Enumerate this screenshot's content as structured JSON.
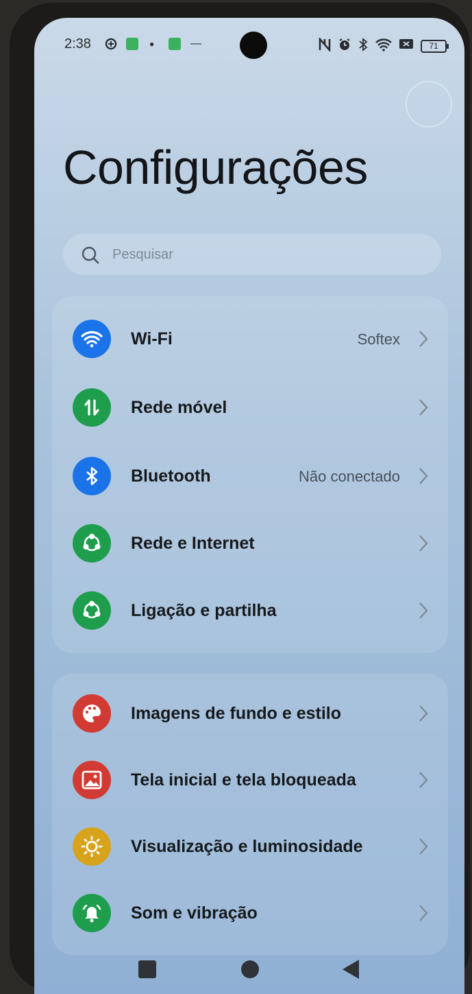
{
  "status_bar": {
    "time": "2:38",
    "battery": "71",
    "icons": [
      "alarm-icon",
      "bluetooth-icon",
      "wifi-icon",
      "nfc-icon"
    ]
  },
  "header": {
    "title": "Configurações"
  },
  "search": {
    "placeholder": "Pesquisar"
  },
  "groups": [
    {
      "items": [
        {
          "label": "Wi-Fi",
          "value": "Softex",
          "icon": "wifi-icon",
          "color": "#1a73e8"
        },
        {
          "label": "Rede móvel",
          "value": "",
          "icon": "mobile-data-icon",
          "color": "#1e9e4c"
        },
        {
          "label": "Bluetooth",
          "value": "Não conectado",
          "icon": "bluetooth-icon",
          "color": "#1a73e8"
        },
        {
          "label": "Rede e Internet",
          "value": "",
          "icon": "network-icon",
          "color": "#1e9e4c"
        },
        {
          "label": "Ligação e partilha",
          "value": "",
          "icon": "share-icon",
          "color": "#1e9e4c"
        }
      ]
    },
    {
      "items": [
        {
          "label": "Imagens de fundo e estilo",
          "value": "",
          "icon": "palette-icon",
          "color": "#d23b33"
        },
        {
          "label": "Tela inicial e tela bloqueada",
          "value": "",
          "icon": "image-icon",
          "color": "#d23b33"
        },
        {
          "label": "Visualização e luminosidade",
          "value": "",
          "icon": "brightness-icon",
          "color": "#d7a31c"
        },
        {
          "label": "Som e vibração",
          "value": "",
          "icon": "bell-icon",
          "color": "#1e9e4c"
        }
      ]
    }
  ]
}
